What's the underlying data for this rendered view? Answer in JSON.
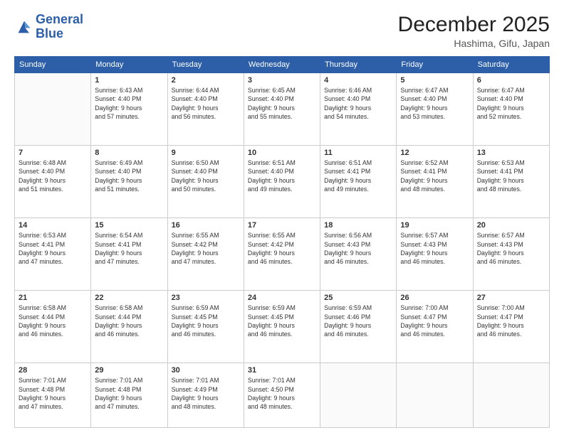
{
  "header": {
    "logo_line1": "General",
    "logo_line2": "Blue",
    "month": "December 2025",
    "location": "Hashima, Gifu, Japan"
  },
  "days_of_week": [
    "Sunday",
    "Monday",
    "Tuesday",
    "Wednesday",
    "Thursday",
    "Friday",
    "Saturday"
  ],
  "weeks": [
    [
      {
        "day": "",
        "info": ""
      },
      {
        "day": "1",
        "info": "Sunrise: 6:43 AM\nSunset: 4:40 PM\nDaylight: 9 hours\nand 57 minutes."
      },
      {
        "day": "2",
        "info": "Sunrise: 6:44 AM\nSunset: 4:40 PM\nDaylight: 9 hours\nand 56 minutes."
      },
      {
        "day": "3",
        "info": "Sunrise: 6:45 AM\nSunset: 4:40 PM\nDaylight: 9 hours\nand 55 minutes."
      },
      {
        "day": "4",
        "info": "Sunrise: 6:46 AM\nSunset: 4:40 PM\nDaylight: 9 hours\nand 54 minutes."
      },
      {
        "day": "5",
        "info": "Sunrise: 6:47 AM\nSunset: 4:40 PM\nDaylight: 9 hours\nand 53 minutes."
      },
      {
        "day": "6",
        "info": "Sunrise: 6:47 AM\nSunset: 4:40 PM\nDaylight: 9 hours\nand 52 minutes."
      }
    ],
    [
      {
        "day": "7",
        "info": "Sunrise: 6:48 AM\nSunset: 4:40 PM\nDaylight: 9 hours\nand 51 minutes."
      },
      {
        "day": "8",
        "info": "Sunrise: 6:49 AM\nSunset: 4:40 PM\nDaylight: 9 hours\nand 51 minutes."
      },
      {
        "day": "9",
        "info": "Sunrise: 6:50 AM\nSunset: 4:40 PM\nDaylight: 9 hours\nand 50 minutes."
      },
      {
        "day": "10",
        "info": "Sunrise: 6:51 AM\nSunset: 4:40 PM\nDaylight: 9 hours\nand 49 minutes."
      },
      {
        "day": "11",
        "info": "Sunrise: 6:51 AM\nSunset: 4:41 PM\nDaylight: 9 hours\nand 49 minutes."
      },
      {
        "day": "12",
        "info": "Sunrise: 6:52 AM\nSunset: 4:41 PM\nDaylight: 9 hours\nand 48 minutes."
      },
      {
        "day": "13",
        "info": "Sunrise: 6:53 AM\nSunset: 4:41 PM\nDaylight: 9 hours\nand 48 minutes."
      }
    ],
    [
      {
        "day": "14",
        "info": "Sunrise: 6:53 AM\nSunset: 4:41 PM\nDaylight: 9 hours\nand 47 minutes."
      },
      {
        "day": "15",
        "info": "Sunrise: 6:54 AM\nSunset: 4:41 PM\nDaylight: 9 hours\nand 47 minutes."
      },
      {
        "day": "16",
        "info": "Sunrise: 6:55 AM\nSunset: 4:42 PM\nDaylight: 9 hours\nand 47 minutes."
      },
      {
        "day": "17",
        "info": "Sunrise: 6:55 AM\nSunset: 4:42 PM\nDaylight: 9 hours\nand 46 minutes."
      },
      {
        "day": "18",
        "info": "Sunrise: 6:56 AM\nSunset: 4:43 PM\nDaylight: 9 hours\nand 46 minutes."
      },
      {
        "day": "19",
        "info": "Sunrise: 6:57 AM\nSunset: 4:43 PM\nDaylight: 9 hours\nand 46 minutes."
      },
      {
        "day": "20",
        "info": "Sunrise: 6:57 AM\nSunset: 4:43 PM\nDaylight: 9 hours\nand 46 minutes."
      }
    ],
    [
      {
        "day": "21",
        "info": "Sunrise: 6:58 AM\nSunset: 4:44 PM\nDaylight: 9 hours\nand 46 minutes."
      },
      {
        "day": "22",
        "info": "Sunrise: 6:58 AM\nSunset: 4:44 PM\nDaylight: 9 hours\nand 46 minutes."
      },
      {
        "day": "23",
        "info": "Sunrise: 6:59 AM\nSunset: 4:45 PM\nDaylight: 9 hours\nand 46 minutes."
      },
      {
        "day": "24",
        "info": "Sunrise: 6:59 AM\nSunset: 4:45 PM\nDaylight: 9 hours\nand 46 minutes."
      },
      {
        "day": "25",
        "info": "Sunrise: 6:59 AM\nSunset: 4:46 PM\nDaylight: 9 hours\nand 46 minutes."
      },
      {
        "day": "26",
        "info": "Sunrise: 7:00 AM\nSunset: 4:47 PM\nDaylight: 9 hours\nand 46 minutes."
      },
      {
        "day": "27",
        "info": "Sunrise: 7:00 AM\nSunset: 4:47 PM\nDaylight: 9 hours\nand 46 minutes."
      }
    ],
    [
      {
        "day": "28",
        "info": "Sunrise: 7:01 AM\nSunset: 4:48 PM\nDaylight: 9 hours\nand 47 minutes."
      },
      {
        "day": "29",
        "info": "Sunrise: 7:01 AM\nSunset: 4:48 PM\nDaylight: 9 hours\nand 47 minutes."
      },
      {
        "day": "30",
        "info": "Sunrise: 7:01 AM\nSunset: 4:49 PM\nDaylight: 9 hours\nand 48 minutes."
      },
      {
        "day": "31",
        "info": "Sunrise: 7:01 AM\nSunset: 4:50 PM\nDaylight: 9 hours\nand 48 minutes."
      },
      {
        "day": "",
        "info": ""
      },
      {
        "day": "",
        "info": ""
      },
      {
        "day": "",
        "info": ""
      }
    ]
  ]
}
